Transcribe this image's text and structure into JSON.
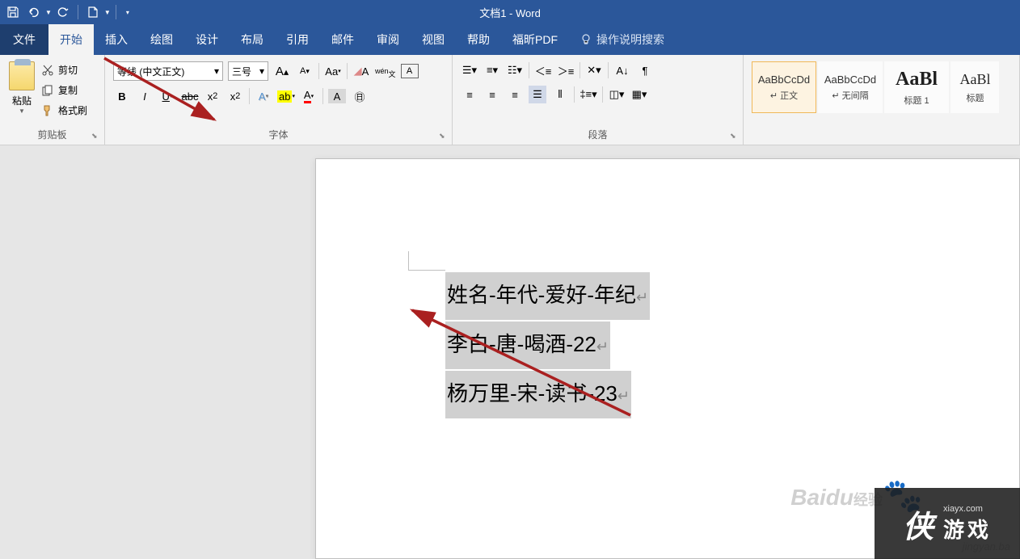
{
  "title": "文档1 - Word",
  "tabs": {
    "file": "文件",
    "items": [
      "开始",
      "插入",
      "绘图",
      "设计",
      "布局",
      "引用",
      "邮件",
      "审阅",
      "视图",
      "帮助",
      "福昕PDF"
    ],
    "tell_me": "操作说明搜索"
  },
  "clipboard": {
    "paste": "粘贴",
    "cut": "剪切",
    "copy": "复制",
    "format_painter": "格式刷",
    "label": "剪贴板"
  },
  "font": {
    "name": "等线 (中文正文)",
    "size": "三号",
    "label": "字体"
  },
  "paragraph": {
    "label": "段落"
  },
  "styles": {
    "items": [
      {
        "preview": "AaBbCcDd",
        "name": "↵ 正文",
        "cls": ""
      },
      {
        "preview": "AaBbCcDd",
        "name": "↵ 无间隔",
        "cls": ""
      },
      {
        "preview": "AaBl",
        "name": "标题 1",
        "cls": "heading1"
      },
      {
        "preview": "AaBl",
        "name": "标题",
        "cls": "heading2"
      }
    ]
  },
  "document": {
    "lines": [
      "姓名-年代-爱好-年纪",
      "李白-唐-喝酒-22",
      "杨万里-宋-读书-23"
    ]
  },
  "watermarks": {
    "baidu": "Baidu",
    "jingyan_text": "经验",
    "jingyan_url": "jingyan.ba",
    "overlay_url": "xiayx.com",
    "overlay_logo": "侠",
    "overlay_cn": "游戏"
  }
}
